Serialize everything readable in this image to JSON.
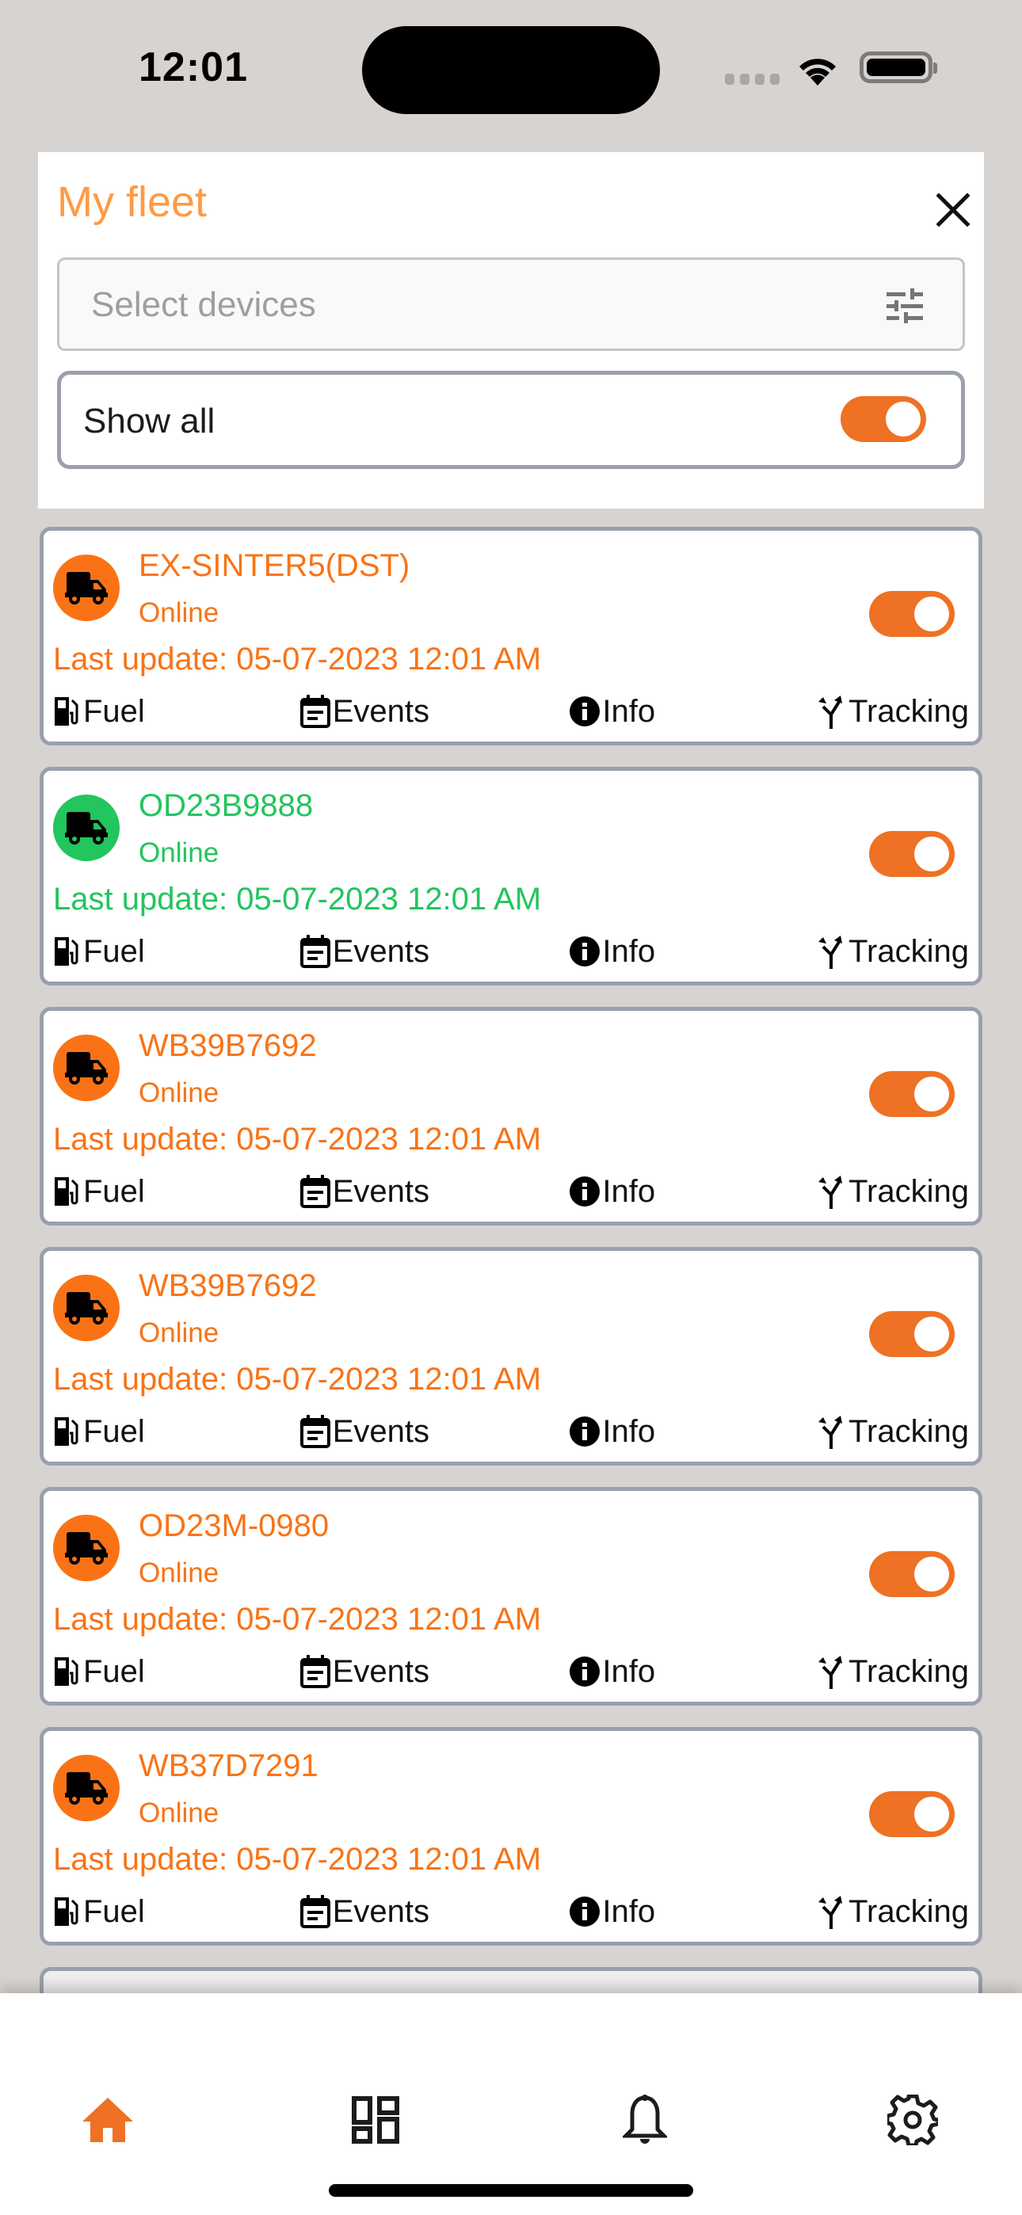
{
  "status_bar": {
    "time": "12:01",
    "icons": [
      "signal-icon",
      "wifi-icon",
      "battery-icon"
    ]
  },
  "colors": {
    "accent": "#EE7124",
    "title": "#FF9A44",
    "online_orange": "#F97316",
    "online_green": "#22C55E",
    "card_border": "#9AA0AC",
    "background": "#D7D3D0"
  },
  "panel": {
    "title": "My fleet",
    "close_icon": "close-icon",
    "select": {
      "placeholder": "Select devices",
      "value": "",
      "icon": "tune-filter-icon"
    },
    "show_all": {
      "label": "Show all",
      "enabled": true
    }
  },
  "devices": [
    {
      "name": "EX-SINTER5(DST)",
      "status": "Online",
      "last_update": "Last update: 05-07-2023 12:01 AM",
      "color": "#F97316",
      "enabled": true
    },
    {
      "name": "OD23B9888",
      "status": "Online",
      "last_update": "Last update: 05-07-2023 12:01 AM",
      "color": "#22C55E",
      "enabled": true
    },
    {
      "name": "WB39B7692",
      "status": "Online",
      "last_update": "Last update: 05-07-2023 12:01 AM",
      "color": "#F97316",
      "enabled": true
    },
    {
      "name": "WB39B7692",
      "status": "Online",
      "last_update": "Last update: 05-07-2023 12:01 AM",
      "color": "#F97316",
      "enabled": true
    },
    {
      "name": "OD23M-0980",
      "status": "Online",
      "last_update": "Last update: 05-07-2023 12:01 AM",
      "color": "#F97316",
      "enabled": true
    },
    {
      "name": "WB37D7291",
      "status": "Online",
      "last_update": "Last update: 05-07-2023 12:01 AM",
      "color": "#F97316",
      "enabled": true
    }
  ],
  "card_actions": {
    "fuel": "Fuel",
    "events": "Events",
    "info": "Info",
    "tracking": "Tracking"
  },
  "bottom_nav": {
    "items": [
      {
        "name": "home",
        "icon": "home-icon",
        "active": true
      },
      {
        "name": "dashboard",
        "icon": "dashboard-icon",
        "active": false
      },
      {
        "name": "notifications",
        "icon": "bell-icon",
        "active": false
      },
      {
        "name": "settings",
        "icon": "gear-icon",
        "active": false
      }
    ]
  }
}
